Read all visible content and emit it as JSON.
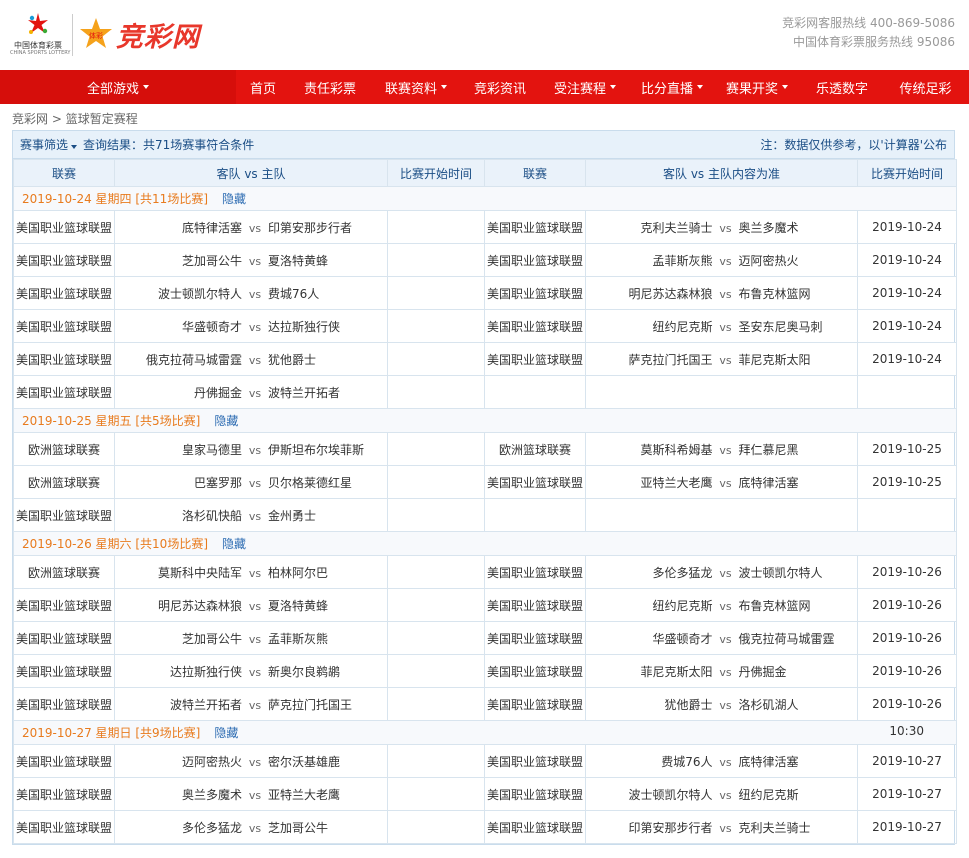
{
  "header": {
    "cslot_cn": "中国体育彩票",
    "cslot_en": "CHINA SPORTS LOTTERY",
    "site_name": "竞彩网",
    "hotline1": "竞彩网客服热线 400-869-5086",
    "hotline2": "中国体育彩票服务热线 95086"
  },
  "nav": {
    "all": "全部游戏",
    "items": [
      "首页",
      "责任彩票",
      "联赛资料",
      "竞彩资讯",
      "受注赛程",
      "比分直播",
      "赛果开奖",
      "乐透数字",
      "传统足彩"
    ]
  },
  "breadcrumb": {
    "home": "竞彩网",
    "sep": " > ",
    "current": "篮球暂定赛程"
  },
  "filter": {
    "label": "赛事筛选",
    "count": "查询结果：共71场赛事符合条件",
    "note": "注：数据仅供参考，以'计算器'公布"
  },
  "columns": [
    "联赛",
    "客队 vs 主队",
    "比赛开始时间",
    "联赛",
    "客队 vs 主队内容为准",
    "比赛开始时间"
  ],
  "vs": "vs",
  "groups": [
    {
      "date": "2019-10-24 星期四 [共11场比赛]",
      "hide": "隐藏",
      "time": "",
      "rows": [
        [
          [
            "美国职业篮球联盟",
            "底特律活塞",
            "印第安那步行者",
            ""
          ],
          [
            "美国职业篮球联盟",
            "克利夫兰骑士",
            "奥兰多魔术",
            "2019-10-24"
          ]
        ],
        [
          [
            "美国职业篮球联盟",
            "芝加哥公牛",
            "夏洛特黄蜂",
            ""
          ],
          [
            "美国职业篮球联盟",
            "孟菲斯灰熊",
            "迈阿密热火",
            "2019-10-24"
          ]
        ],
        [
          [
            "美国职业篮球联盟",
            "波士顿凯尔特人",
            "费城76人",
            ""
          ],
          [
            "美国职业篮球联盟",
            "明尼苏达森林狼",
            "布鲁克林篮网",
            "2019-10-24"
          ]
        ],
        [
          [
            "美国职业篮球联盟",
            "华盛顿奇才",
            "达拉斯独行侠",
            ""
          ],
          [
            "美国职业篮球联盟",
            "纽约尼克斯",
            "圣安东尼奥马刺",
            "2019-10-24"
          ]
        ],
        [
          [
            "美国职业篮球联盟",
            "俄克拉荷马城雷霆",
            "犹他爵士",
            ""
          ],
          [
            "美国职业篮球联盟",
            "萨克拉门托国王",
            "菲尼克斯太阳",
            "2019-10-24"
          ]
        ],
        [
          [
            "美国职业篮球联盟",
            "丹佛掘金",
            "波特兰开拓者",
            ""
          ],
          [
            "",
            "",
            "",
            ""
          ]
        ]
      ]
    },
    {
      "date": "2019-10-25 星期五 [共5场比赛]",
      "hide": "隐藏",
      "time": "",
      "rows": [
        [
          [
            "欧洲篮球联赛",
            "皇家马德里",
            "伊斯坦布尔埃菲斯",
            ""
          ],
          [
            "欧洲篮球联赛",
            "莫斯科希姆基",
            "拜仁慕尼黑",
            "2019-10-25"
          ]
        ],
        [
          [
            "欧洲篮球联赛",
            "巴塞罗那",
            "贝尔格莱德红星",
            ""
          ],
          [
            "美国职业篮球联盟",
            "亚特兰大老鹰",
            "底特律活塞",
            "2019-10-25"
          ]
        ],
        [
          [
            "美国职业篮球联盟",
            "洛杉矶快船",
            "金州勇士",
            ""
          ],
          [
            "",
            "",
            "",
            ""
          ]
        ]
      ]
    },
    {
      "date": "2019-10-26 星期六 [共10场比赛]",
      "hide": "隐藏",
      "time": "",
      "rows": [
        [
          [
            "欧洲篮球联赛",
            "莫斯科中央陆军",
            "柏林阿尔巴",
            ""
          ],
          [
            "美国职业篮球联盟",
            "多伦多猛龙",
            "波士顿凯尔特人",
            "2019-10-26"
          ]
        ],
        [
          [
            "美国职业篮球联盟",
            "明尼苏达森林狼",
            "夏洛特黄蜂",
            ""
          ],
          [
            "美国职业篮球联盟",
            "纽约尼克斯",
            "布鲁克林篮网",
            "2019-10-26"
          ]
        ],
        [
          [
            "美国职业篮球联盟",
            "芝加哥公牛",
            "孟菲斯灰熊",
            ""
          ],
          [
            "美国职业篮球联盟",
            "华盛顿奇才",
            "俄克拉荷马城雷霆",
            "2019-10-26"
          ]
        ],
        [
          [
            "美国职业篮球联盟",
            "达拉斯独行侠",
            "新奥尔良鹈鹕",
            ""
          ],
          [
            "美国职业篮球联盟",
            "菲尼克斯太阳",
            "丹佛掘金",
            "2019-10-26"
          ]
        ],
        [
          [
            "美国职业篮球联盟",
            "波特兰开拓者",
            "萨克拉门托国王",
            ""
          ],
          [
            "美国职业篮球联盟",
            "犹他爵士",
            "洛杉矶湖人",
            "2019-10-26"
          ]
        ]
      ]
    },
    {
      "date": "2019-10-27 星期日 [共9场比赛]",
      "hide": "隐藏",
      "time": "10:30",
      "rows": [
        [
          [
            "美国职业篮球联盟",
            "迈阿密热火",
            "密尔沃基雄鹿",
            ""
          ],
          [
            "美国职业篮球联盟",
            "费城76人",
            "底特律活塞",
            "2019-10-27"
          ]
        ],
        [
          [
            "美国职业篮球联盟",
            "奥兰多魔术",
            "亚特兰大老鹰",
            ""
          ],
          [
            "美国职业篮球联盟",
            "波士顿凯尔特人",
            "纽约尼克斯",
            "2019-10-27"
          ]
        ],
        [
          [
            "美国职业篮球联盟",
            "多伦多猛龙",
            "芝加哥公牛",
            ""
          ],
          [
            "美国职业篮球联盟",
            "印第安那步行者",
            "克利夫兰骑士",
            "2019-10-27"
          ]
        ]
      ]
    }
  ]
}
